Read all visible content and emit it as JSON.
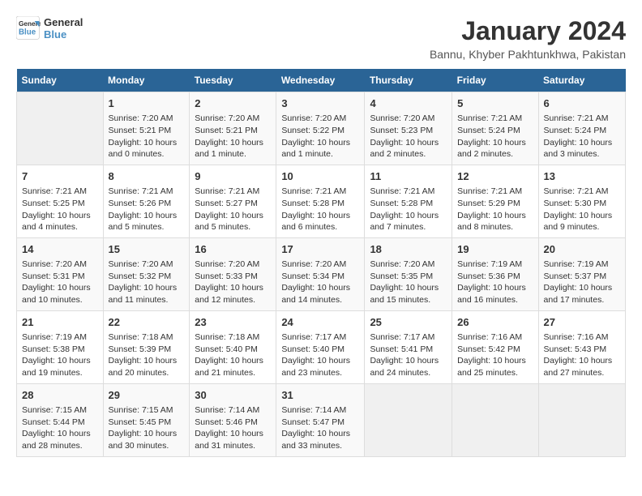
{
  "logo": {
    "text_general": "General",
    "text_blue": "Blue"
  },
  "title": "January 2024",
  "subtitle": "Bannu, Khyber Pakhtunkhwa, Pakistan",
  "headers": [
    "Sunday",
    "Monday",
    "Tuesday",
    "Wednesday",
    "Thursday",
    "Friday",
    "Saturday"
  ],
  "weeks": [
    [
      {
        "day": "",
        "info": ""
      },
      {
        "day": "1",
        "info": "Sunrise: 7:20 AM\nSunset: 5:21 PM\nDaylight: 10 hours\nand 0 minutes."
      },
      {
        "day": "2",
        "info": "Sunrise: 7:20 AM\nSunset: 5:21 PM\nDaylight: 10 hours\nand 1 minute."
      },
      {
        "day": "3",
        "info": "Sunrise: 7:20 AM\nSunset: 5:22 PM\nDaylight: 10 hours\nand 1 minute."
      },
      {
        "day": "4",
        "info": "Sunrise: 7:20 AM\nSunset: 5:23 PM\nDaylight: 10 hours\nand 2 minutes."
      },
      {
        "day": "5",
        "info": "Sunrise: 7:21 AM\nSunset: 5:24 PM\nDaylight: 10 hours\nand 2 minutes."
      },
      {
        "day": "6",
        "info": "Sunrise: 7:21 AM\nSunset: 5:24 PM\nDaylight: 10 hours\nand 3 minutes."
      }
    ],
    [
      {
        "day": "7",
        "info": "Sunrise: 7:21 AM\nSunset: 5:25 PM\nDaylight: 10 hours\nand 4 minutes."
      },
      {
        "day": "8",
        "info": "Sunrise: 7:21 AM\nSunset: 5:26 PM\nDaylight: 10 hours\nand 5 minutes."
      },
      {
        "day": "9",
        "info": "Sunrise: 7:21 AM\nSunset: 5:27 PM\nDaylight: 10 hours\nand 5 minutes."
      },
      {
        "day": "10",
        "info": "Sunrise: 7:21 AM\nSunset: 5:28 PM\nDaylight: 10 hours\nand 6 minutes."
      },
      {
        "day": "11",
        "info": "Sunrise: 7:21 AM\nSunset: 5:28 PM\nDaylight: 10 hours\nand 7 minutes."
      },
      {
        "day": "12",
        "info": "Sunrise: 7:21 AM\nSunset: 5:29 PM\nDaylight: 10 hours\nand 8 minutes."
      },
      {
        "day": "13",
        "info": "Sunrise: 7:21 AM\nSunset: 5:30 PM\nDaylight: 10 hours\nand 9 minutes."
      }
    ],
    [
      {
        "day": "14",
        "info": "Sunrise: 7:20 AM\nSunset: 5:31 PM\nDaylight: 10 hours\nand 10 minutes."
      },
      {
        "day": "15",
        "info": "Sunrise: 7:20 AM\nSunset: 5:32 PM\nDaylight: 10 hours\nand 11 minutes."
      },
      {
        "day": "16",
        "info": "Sunrise: 7:20 AM\nSunset: 5:33 PM\nDaylight: 10 hours\nand 12 minutes."
      },
      {
        "day": "17",
        "info": "Sunrise: 7:20 AM\nSunset: 5:34 PM\nDaylight: 10 hours\nand 14 minutes."
      },
      {
        "day": "18",
        "info": "Sunrise: 7:20 AM\nSunset: 5:35 PM\nDaylight: 10 hours\nand 15 minutes."
      },
      {
        "day": "19",
        "info": "Sunrise: 7:19 AM\nSunset: 5:36 PM\nDaylight: 10 hours\nand 16 minutes."
      },
      {
        "day": "20",
        "info": "Sunrise: 7:19 AM\nSunset: 5:37 PM\nDaylight: 10 hours\nand 17 minutes."
      }
    ],
    [
      {
        "day": "21",
        "info": "Sunrise: 7:19 AM\nSunset: 5:38 PM\nDaylight: 10 hours\nand 19 minutes."
      },
      {
        "day": "22",
        "info": "Sunrise: 7:18 AM\nSunset: 5:39 PM\nDaylight: 10 hours\nand 20 minutes."
      },
      {
        "day": "23",
        "info": "Sunrise: 7:18 AM\nSunset: 5:40 PM\nDaylight: 10 hours\nand 21 minutes."
      },
      {
        "day": "24",
        "info": "Sunrise: 7:17 AM\nSunset: 5:40 PM\nDaylight: 10 hours\nand 23 minutes."
      },
      {
        "day": "25",
        "info": "Sunrise: 7:17 AM\nSunset: 5:41 PM\nDaylight: 10 hours\nand 24 minutes."
      },
      {
        "day": "26",
        "info": "Sunrise: 7:16 AM\nSunset: 5:42 PM\nDaylight: 10 hours\nand 25 minutes."
      },
      {
        "day": "27",
        "info": "Sunrise: 7:16 AM\nSunset: 5:43 PM\nDaylight: 10 hours\nand 27 minutes."
      }
    ],
    [
      {
        "day": "28",
        "info": "Sunrise: 7:15 AM\nSunset: 5:44 PM\nDaylight: 10 hours\nand 28 minutes."
      },
      {
        "day": "29",
        "info": "Sunrise: 7:15 AM\nSunset: 5:45 PM\nDaylight: 10 hours\nand 30 minutes."
      },
      {
        "day": "30",
        "info": "Sunrise: 7:14 AM\nSunset: 5:46 PM\nDaylight: 10 hours\nand 31 minutes."
      },
      {
        "day": "31",
        "info": "Sunrise: 7:14 AM\nSunset: 5:47 PM\nDaylight: 10 hours\nand 33 minutes."
      },
      {
        "day": "",
        "info": ""
      },
      {
        "day": "",
        "info": ""
      },
      {
        "day": "",
        "info": ""
      }
    ]
  ]
}
